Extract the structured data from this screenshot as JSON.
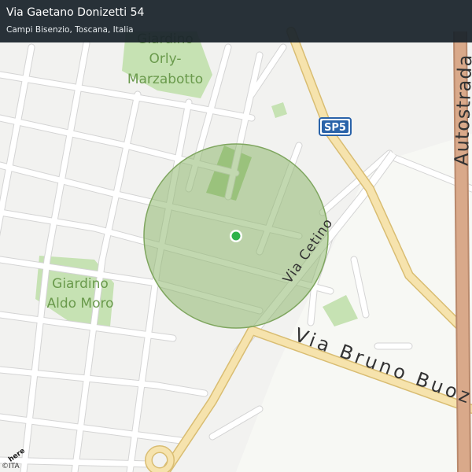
{
  "header": {
    "title": "Via Gaetano Donizetti 54",
    "subtitle": "Campi Bisenzio, Toscana, Italia"
  },
  "map": {
    "labels": {
      "park_orly": [
        "Giardino",
        "Orly-",
        "Marzabotto"
      ],
      "park_moro": [
        "Giardino",
        "Aldo Moro"
      ],
      "road_cetino": "Via Cetino",
      "road_buozzi": "Via Bruno Buoz",
      "road_autostrada": "Autostrada",
      "shield_sp5": "SP5"
    },
    "colors": {
      "land": "#f2f2f0",
      "road": "#ffffff",
      "road_casing": "#d6d6d6",
      "major_road": "#f6e3ad",
      "major_casing": "#d9bd72",
      "motorway": "#d9a98a",
      "park": "#c6e2b3",
      "park_text": "#6a9a4c",
      "radius_fill": "#8fb870",
      "marker": "#2eb24a",
      "shield": "#2a63a9"
    }
  },
  "footer": {
    "attribution": "©ITA",
    "logo": "here"
  }
}
